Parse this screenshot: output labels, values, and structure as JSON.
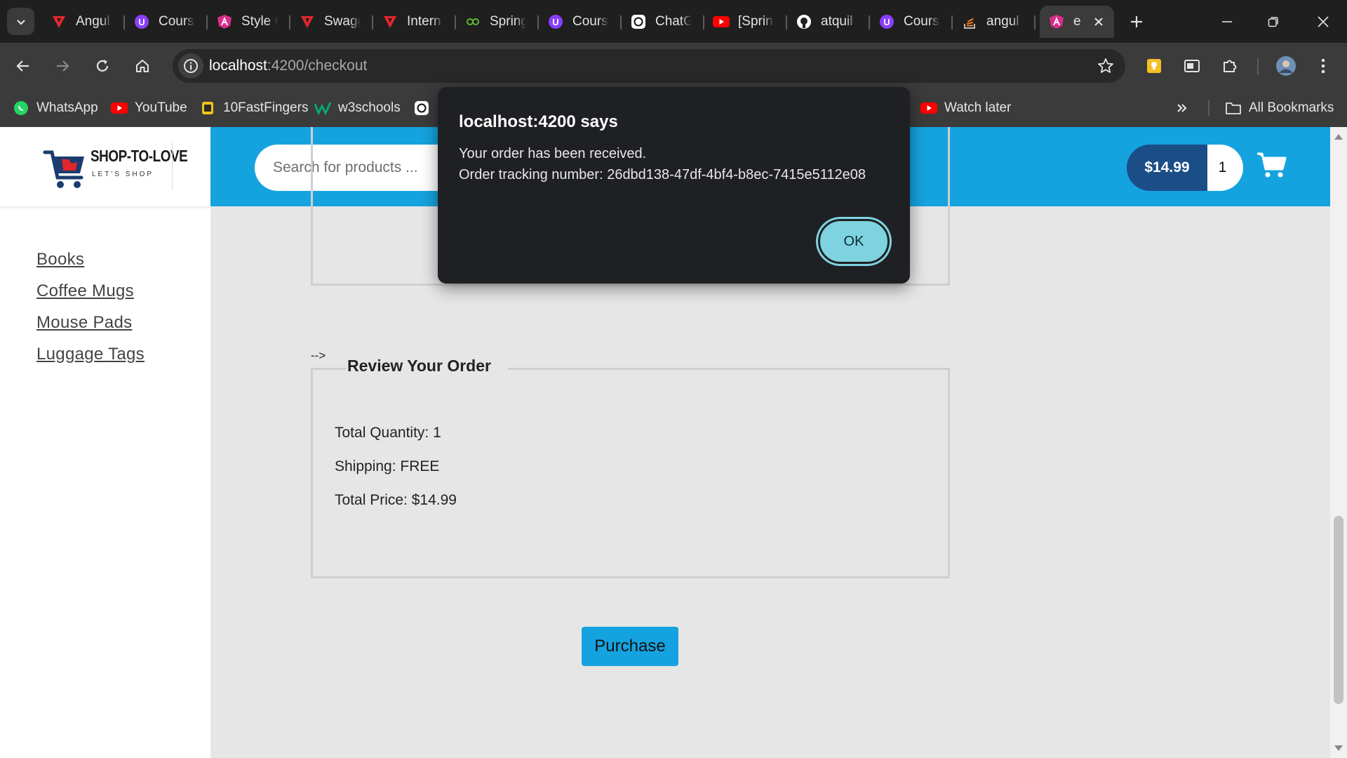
{
  "browser": {
    "tabs": [
      {
        "title": "Angul",
        "icon": "angular-red-icon"
      },
      {
        "title": "Cours",
        "icon": "udemy-icon"
      },
      {
        "title": "Style G",
        "icon": "angular-icon"
      },
      {
        "title": "Swagg",
        "icon": "angular-red-icon"
      },
      {
        "title": "Intern",
        "icon": "angular-red-icon"
      },
      {
        "title": "Spring",
        "icon": "spring-icon"
      },
      {
        "title": "Cours",
        "icon": "udemy-icon"
      },
      {
        "title": "ChatG",
        "icon": "chatgpt-icon"
      },
      {
        "title": "[Sprin",
        "icon": "youtube-icon"
      },
      {
        "title": "atquil",
        "icon": "github-icon"
      },
      {
        "title": "Cours",
        "icon": "udemy-icon"
      },
      {
        "title": "angul",
        "icon": "stackoverflow-icon"
      },
      {
        "title": "e",
        "icon": "angular-icon",
        "active": true
      }
    ],
    "address": {
      "host": "localhost",
      "rest": ":4200/checkout"
    },
    "bookmarks": [
      {
        "label": "WhatsApp",
        "icon": "whatsapp-icon"
      },
      {
        "label": "YouTube",
        "icon": "youtube-icon"
      },
      {
        "label": "10FastFingers",
        "icon": "10fastfingers-icon"
      },
      {
        "label": "w3schools",
        "icon": "w3schools-icon"
      },
      {
        "label": "Watch later",
        "icon": "youtube-icon"
      }
    ],
    "all_bookmarks": "All Bookmarks"
  },
  "site": {
    "logo_title": "SHOP-TO-LOVE",
    "logo_sub": "LET'S SHOP",
    "categories": [
      "Books",
      "Coffee Mugs",
      "Mouse Pads",
      "Luggage Tags"
    ],
    "search_placeholder": "Search for products ...",
    "cart_total": "$14.99",
    "cart_quantity": "1"
  },
  "checkout": {
    "comment_text": "-->",
    "review_title": "Review Your Order",
    "total_quantity": "Total Quantity: 1",
    "shipping": "Shipping: FREE",
    "total_price": "Total Price: $14.99",
    "purchase_label": "Purchase"
  },
  "dialog": {
    "title": "localhost:4200 says",
    "line1": "Your order has been received.",
    "line2": "Order tracking number: 26dbd138-47df-4bf4-b8ec-7415e5112e08",
    "ok_label": "OK"
  },
  "colors": {
    "header_blue": "#15a3e0",
    "cart_total_bg": "#1b4d86",
    "ok_button": "#7ed3e0",
    "dialog_bg": "#1f2023"
  }
}
